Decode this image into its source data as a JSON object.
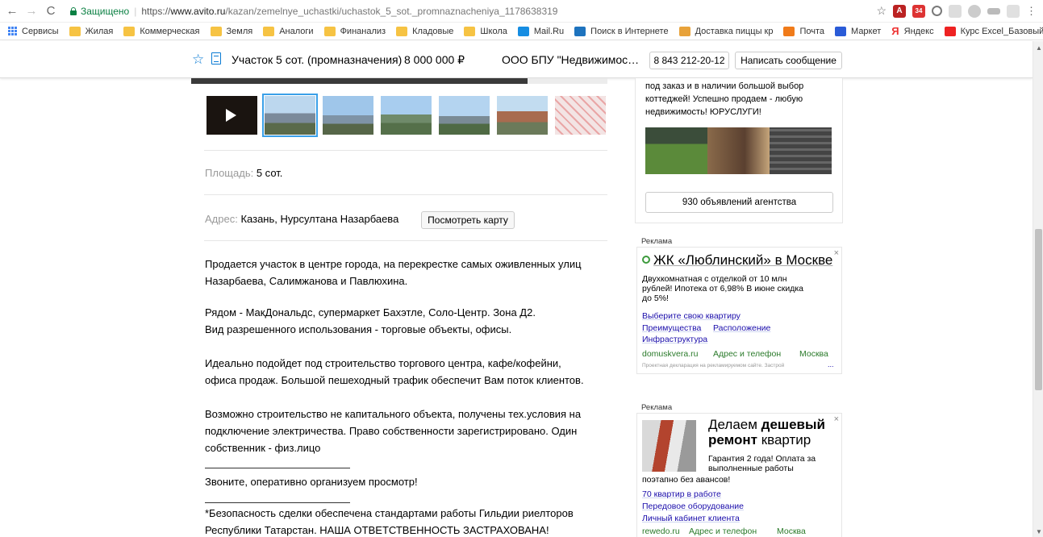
{
  "browser": {
    "secure_label": "Защищено",
    "url_scheme": "https://",
    "url_host": "www.avito.ru",
    "url_path": "/kazan/zemelnye_uchastki/uchastok_5_sot._promnaznacheniya_1178638319",
    "bookmarks": [
      "Сервисы",
      "Жилая",
      "Коммерческая",
      "Земля",
      "Аналоги",
      "Финанализ",
      "Кладовые",
      "Школа",
      "Mail.Ru",
      "Поиск в Интернете",
      "Доставка пиццы кр",
      "Почта",
      "Маркет",
      "Яндекс",
      "Курс Excel_Базовый"
    ],
    "bookmarks_more": "»",
    "ext_badge": "34"
  },
  "sticky": {
    "title": "Участок 5 сот. (промназначения)",
    "price": "8 000 000 ₽",
    "seller": "ООО БПУ \"Недвижимос…",
    "phone": "8 843 212-20-12",
    "message_button": "Написать сообщение"
  },
  "listing": {
    "area_label": "Площадь:",
    "area_value": "5 сот.",
    "address_label": "Адрес:",
    "address_value": "Казань, Нурсултана Назарбаева",
    "map_button": "Посмотреть карту",
    "description": [
      "Продается участок в центре города, на перекрестке самых оживленных улиц",
      "Назарбаева, Салимжанова и Павлюхина.",
      "Рядом - МакДональдс, супермаркет Бахэтле, Соло-Центр. Зона Д2.",
      "Вид разрешенного использования - торговые объекты, офисы.",
      "Идеально подойдет под строительство торгового центра, кафе/кофейни,",
      "офиса продаж. Большой пешеходный трафик обеспечит Вам поток клиентов.",
      "Возможно строительство не капитального объекта, получены тех.условия на",
      "подключение электричества. Право собственности зарегистрировано. Один",
      "собственник - физ.лицо",
      "Звоните, оперативно организуем просмотр!",
      "*Безопасность сделки обеспечена стандартами работы Гильдии риелторов",
      "Республики Татарстан. НАША ОТВЕТСТВЕННОСТЬ ЗАСТРАХОВАНА!"
    ]
  },
  "agency": {
    "text_lines": [
      "под заказ и в наличии большой выбор",
      "коттеджей! Успешно продаем - любую",
      "недвижимость! ЮРУСЛУГИ!"
    ],
    "button": "930 объявлений агентства"
  },
  "ad1": {
    "label": "Реклама",
    "title": "ЖК «Люблинский» в Москве",
    "body": [
      "Двухкомнатная с отделкой от 10 млн",
      "рублей! Ипотека от 6,98% В июне скидка",
      "до 5%!"
    ],
    "link1": "Выберите свою квартиру",
    "link2": "Преимущества",
    "link3": "Расположение",
    "link4": "Инфраструктура",
    "domain": "domuskvera.ru",
    "contacts": "Адрес и телефон",
    "city": "Москва",
    "disclaimer": "Проектная декларация на рекламируемом сайте. Застрой",
    "more": "..."
  },
  "ad2": {
    "label": "Реклама",
    "title_1": "Делаем",
    "title_bold_1": "дешевый",
    "title_bold_2": "ремонт",
    "title_2": "квартир",
    "body": [
      "Гарантия 2 года! Оплата за",
      "выполненные работы"
    ],
    "body_wide": "поэтапно без авансов!",
    "link1": "70 квартир в работе",
    "link2": "Передовое оборудование",
    "link3": "Личный кабинет клиента",
    "domain": "rewedo.ru",
    "contacts": "Адрес и телефон",
    "city": "Москва"
  },
  "colors": {
    "accent": "#0a7bd4",
    "link": "#1a0dab",
    "secure": "#0b8043",
    "ad_domain": "#2a7a2a"
  }
}
